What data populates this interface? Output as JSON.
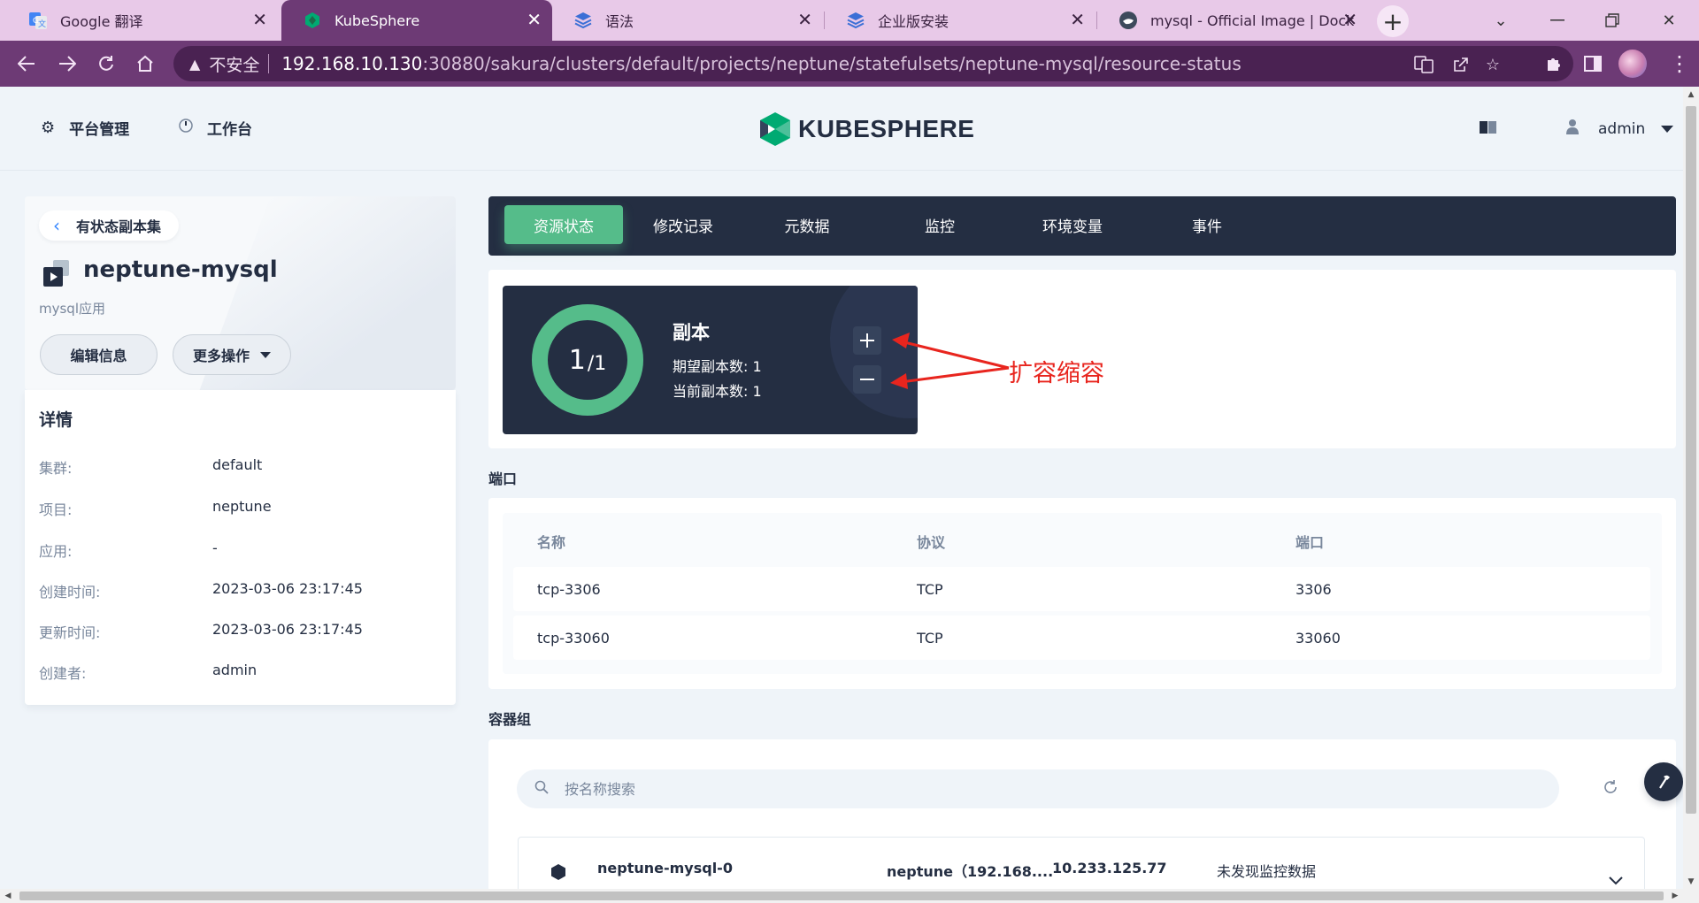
{
  "browser": {
    "tabs": [
      {
        "title": "Google 翻译",
        "icon": "google-translate-icon"
      },
      {
        "title": "KubeSphere",
        "icon": "kubesphere-icon"
      },
      {
        "title": "语法",
        "icon": "stack-icon"
      },
      {
        "title": "企业版安装",
        "icon": "stack-icon"
      },
      {
        "title": "mysql - Official Image | Dock",
        "icon": "docker-icon"
      }
    ],
    "active_tab": "KubeSphere",
    "security_label": "不安全",
    "url_host": "192.168.10.130",
    "url_rest": ":30880/sakura/clusters/default/projects/neptune/statefulsets/neptune-mysql/resource-status"
  },
  "header": {
    "platform_label": "平台管理",
    "workbench_label": "工作台",
    "logo_text": "KUBESPHERE",
    "username": "admin"
  },
  "sidebar": {
    "back_label": "有状态副本集",
    "resource_name": "neptune-mysql",
    "description": "mysql应用",
    "edit_button": "编辑信息",
    "more_button": "更多操作",
    "details_title": "详情",
    "details": [
      {
        "label": "集群:",
        "value": "default"
      },
      {
        "label": "项目:",
        "value": "neptune"
      },
      {
        "label": "应用:",
        "value": "-"
      },
      {
        "label": "创建时间:",
        "value": "2023-03-06 23:17:45"
      },
      {
        "label": "更新时间:",
        "value": "2023-03-06 23:17:45"
      },
      {
        "label": "创建者:",
        "value": "admin"
      }
    ]
  },
  "tabs": [
    {
      "label": "资源状态",
      "active": true
    },
    {
      "label": "修改记录",
      "active": false
    },
    {
      "label": "元数据",
      "active": false
    },
    {
      "label": "监控",
      "active": false
    },
    {
      "label": "环境变量",
      "active": false
    },
    {
      "label": "事件",
      "active": false
    }
  ],
  "replicas": {
    "current": "1",
    "desired": "/1",
    "title": "副本",
    "desired_line": "期望副本数: 1",
    "current_line": "当前副本数: 1",
    "ratio": 1.0,
    "ring_color": "#55bc8a",
    "annotation": "扩容缩容",
    "annotation_color": "#e8251e"
  },
  "ports": {
    "section_title": "端口",
    "headers": [
      "名称",
      "协议",
      "端口"
    ],
    "rows": [
      [
        "tcp-3306",
        "TCP",
        "3306"
      ],
      [
        "tcp-33060",
        "TCP",
        "33060"
      ]
    ]
  },
  "pods": {
    "section_title": "容器组",
    "search_placeholder": "按名称搜索",
    "rows": [
      {
        "name": "neptune-mysql-0",
        "node": "neptune（192.168....",
        "ip": "10.233.125.77",
        "monitor": "未发现监控数据"
      }
    ]
  }
}
